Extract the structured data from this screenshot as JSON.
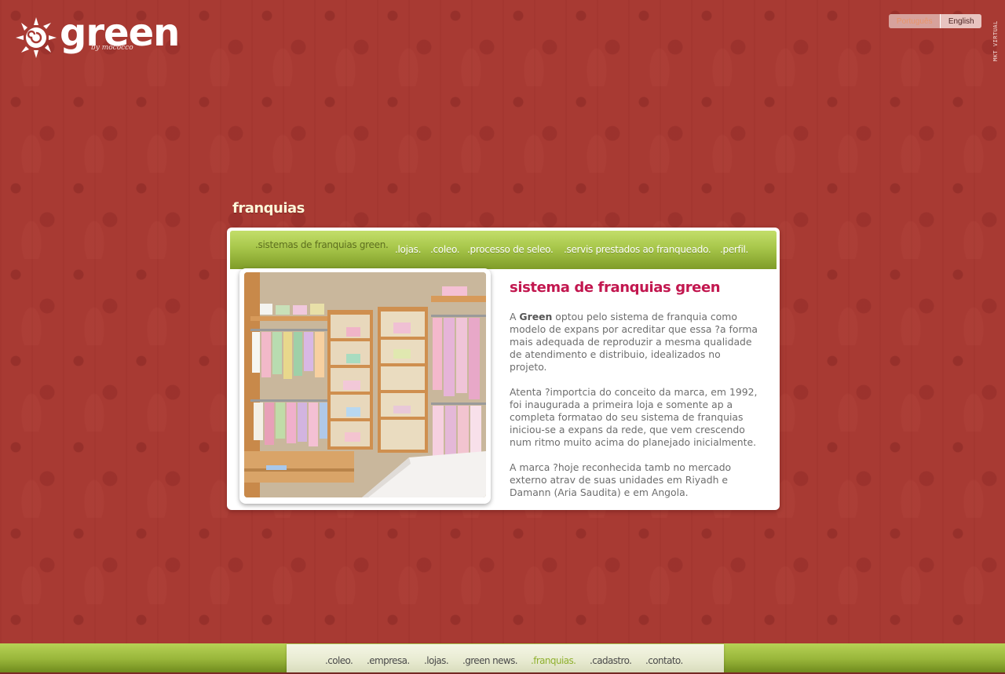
{
  "logo": {
    "word": "green",
    "sub": "by mococco"
  },
  "language": {
    "portuguese": "Português",
    "english": "English",
    "active": "Português"
  },
  "side_credit": "MKT VIRTUAL",
  "section": {
    "title": "franquias"
  },
  "subnav": {
    "items": [
      {
        "label": ".sistemas de franquias green.",
        "active": true
      },
      {
        "label": ".lojas.",
        "active": false
      },
      {
        "label": ".coleo.",
        "active": false
      },
      {
        "label": ".processo de seleo.",
        "active": false
      },
      {
        "label": ".servis prestados ao franqueado.",
        "active": false
      },
      {
        "label": ".perfil.",
        "active": false
      }
    ]
  },
  "content": {
    "title": "sistema de franquias green",
    "p1_prefix": "A ",
    "p1_bold": "Green",
    "p1_rest": " optou pelo sistema de franquia como modelo de expans por acreditar que essa ?a forma mais adequada de reproduzir a mesma qualidade de atendimento e distribuio, idealizados no projeto.",
    "p2": "Atenta ?importcia do conceito da marca, em 1992, foi inaugurada a primeira loja e somente ap a completa formatao do seu sistema de franquias iniciou-se a expans da rede, que vem crescendo num ritmo muito acima do planejado inicialmente.",
    "p3": "A marca ?hoje reconhecida tamb no mercado externo atrav de suas unidades em Riyadh e Damann (Aria Saudita) e em Angola."
  },
  "footer_nav": {
    "items": [
      {
        "label": ".coleo.",
        "active": false
      },
      {
        "label": ".empresa.",
        "active": false
      },
      {
        "label": ".lojas.",
        "active": false
      },
      {
        "label": ".green news.",
        "active": false
      },
      {
        "label": ".franquias.",
        "active": true
      },
      {
        "label": ".cadastro.",
        "active": false
      },
      {
        "label": ".contato.",
        "active": false
      }
    ]
  },
  "colors": {
    "background": "#a83a33",
    "accent_green": "#a7c64a",
    "title_magenta": "#c2174f",
    "active_footer": "#8fb02e"
  }
}
